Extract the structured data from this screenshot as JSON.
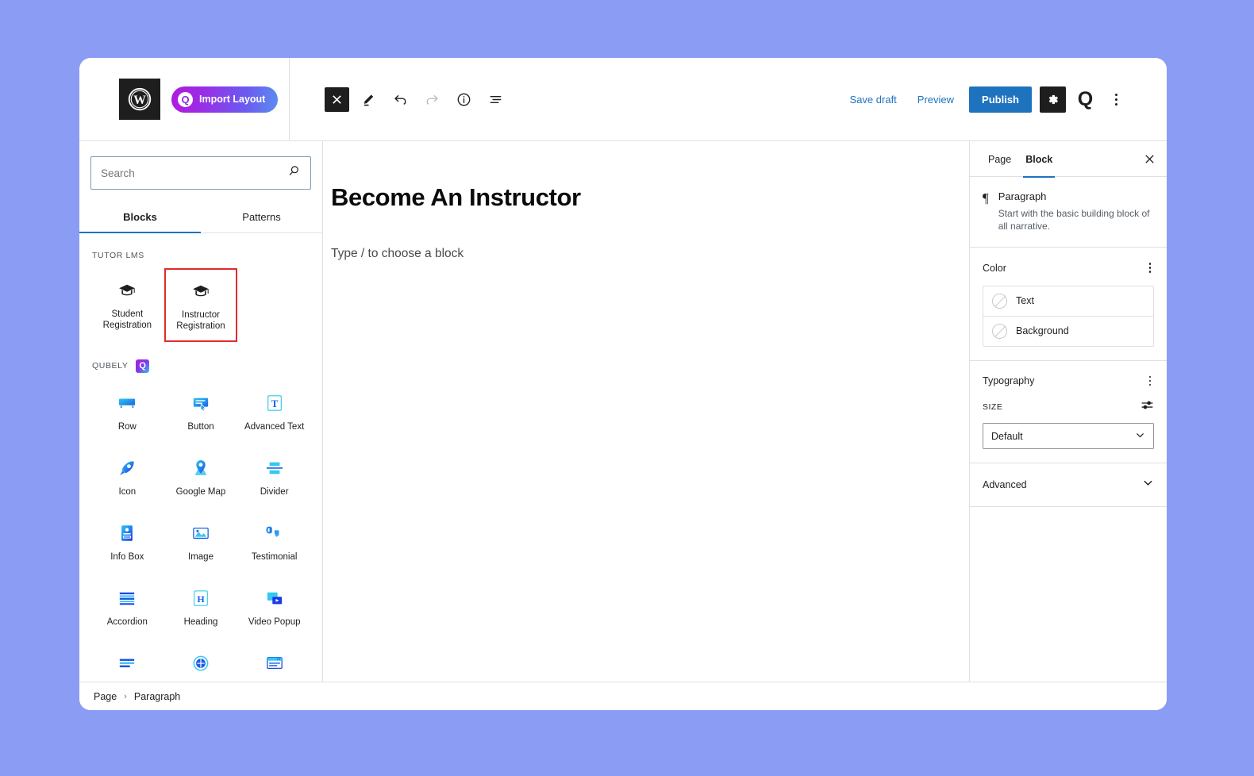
{
  "theme": {
    "desktop_bg": "#8b9cf5",
    "accent_blue": "#1e73be",
    "selection_red": "#e02b2b",
    "dark": "#1e1e1e"
  },
  "toolbar": {
    "wordpress_logo": "wordpress-icon",
    "import_layout_label": "Import Layout",
    "import_layout_badge": "Q",
    "close_inserter_icon": "close-icon",
    "tools_icon": "pencil-icon",
    "undo_icon": "undo-arrow-icon",
    "redo_icon": "redo-arrow-icon",
    "details_icon": "info-icon",
    "list_view_icon": "list-view-icon",
    "save_draft_label": "Save draft",
    "preview_label": "Preview",
    "publish_label": "Publish",
    "settings_gear_icon": "gear-icon",
    "qubely_logo": "Q",
    "more_options_icon": "kebab-menu-icon"
  },
  "inserter": {
    "search": {
      "value": "",
      "placeholder": "Search",
      "icon": "search-icon"
    },
    "tabs": [
      {
        "label": "Blocks",
        "active": true
      },
      {
        "label": "Patterns",
        "active": false
      }
    ],
    "categories": [
      {
        "label": "TUTOR LMS",
        "has_badge": false,
        "blocks": [
          {
            "name": "Student Registration",
            "icon": "graduation-cap-icon",
            "selected": false
          },
          {
            "name": "Instructor Registration",
            "icon": "graduation-cap-icon",
            "selected": true
          }
        ]
      },
      {
        "label": "QUBELY",
        "has_badge": true,
        "badge_text": "Q",
        "blocks": [
          {
            "name": "Row",
            "icon": "row-icon",
            "selected": false
          },
          {
            "name": "Button",
            "icon": "button-icon",
            "selected": false
          },
          {
            "name": "Advanced Text",
            "icon": "advanced-text-icon",
            "selected": false
          },
          {
            "name": "Icon",
            "icon": "rocket-icon",
            "selected": false
          },
          {
            "name": "Google Map",
            "icon": "map-pin-icon",
            "selected": false
          },
          {
            "name": "Divider",
            "icon": "divider-icon",
            "selected": false
          },
          {
            "name": "Info Box",
            "icon": "info-box-icon",
            "selected": false
          },
          {
            "name": "Image",
            "icon": "image-icon",
            "selected": false
          },
          {
            "name": "Testimonial",
            "icon": "quote-icon",
            "selected": false
          },
          {
            "name": "Accordion",
            "icon": "accordion-icon",
            "selected": false
          },
          {
            "name": "Heading",
            "icon": "heading-icon",
            "selected": false
          },
          {
            "name": "Video Popup",
            "icon": "video-popup-icon",
            "selected": false
          },
          {
            "name": "",
            "icon": "list-lines-icon",
            "selected": false
          },
          {
            "name": "",
            "icon": "globe-icon",
            "selected": false
          },
          {
            "name": "",
            "icon": "card-icon",
            "selected": false
          }
        ]
      }
    ]
  },
  "canvas": {
    "post_title": "Become An Instructor",
    "paragraph_placeholder": "Type / to choose a block"
  },
  "settings": {
    "tabs": [
      {
        "label": "Page",
        "active": false
      },
      {
        "label": "Block",
        "active": true
      }
    ],
    "close_icon": "close-icon",
    "block_card": {
      "icon": "paragraph-pilcrow-icon",
      "icon_glyph": "¶",
      "title": "Paragraph",
      "description": "Start with the basic building block of all narrative."
    },
    "color_panel": {
      "title": "Color",
      "options_icon": "kebab-menu-icon",
      "rows": [
        {
          "label": "Text",
          "swatch": "none"
        },
        {
          "label": "Background",
          "swatch": "none"
        }
      ]
    },
    "typography_panel": {
      "title": "Typography",
      "options_icon": "kebab-menu-icon",
      "size_label": "SIZE",
      "size_controls_icon": "sliders-icon",
      "size_value": "Default",
      "chevron_icon": "chevron-down-icon"
    },
    "advanced_panel": {
      "title": "Advanced",
      "chevron_icon": "chevron-down-icon"
    }
  },
  "bottombar": {
    "crumbs": [
      {
        "label": "Page"
      },
      {
        "label": "Paragraph"
      }
    ],
    "separator": "›"
  }
}
